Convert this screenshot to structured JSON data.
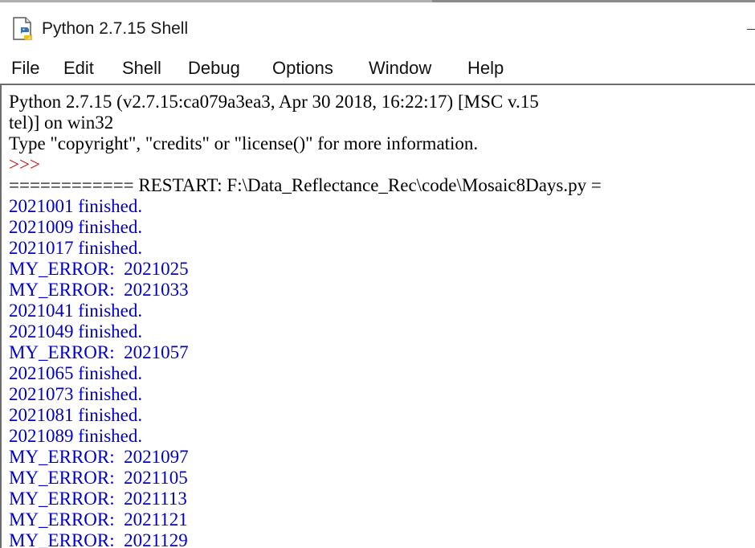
{
  "window": {
    "title": "Python 2.7.15 Shell"
  },
  "menu": [
    {
      "label": "File"
    },
    {
      "label": "Edit"
    },
    {
      "label": "Shell"
    },
    {
      "label": "Debug"
    },
    {
      "label": "Options"
    },
    {
      "label": "Window"
    },
    {
      "label": "Help"
    }
  ],
  "icons": {
    "app": "python-idle-icon",
    "minimize": "minimize-icon"
  },
  "colors": {
    "stdout": "#000000",
    "prompt": "#c00000",
    "output": "#0000c8"
  },
  "shell": {
    "lines": [
      {
        "text": "Python 2.7.15 (v2.7.15:ca079a3ea3, Apr 30 2018, 16:22:17) [MSC v.15",
        "style": "stdout"
      },
      {
        "text": "tel)] on win32",
        "style": "stdout"
      },
      {
        "text": "Type \"copyright\", \"credits\" or \"license()\" for more information.",
        "style": "stdout"
      },
      {
        "text": ">>>",
        "style": "prompt"
      },
      {
        "text": "============ RESTART: F:\\Data_Reflectance_Rec\\code\\Mosaic8Days.py =",
        "style": "stdout"
      },
      {
        "text": "2021001 finished.",
        "style": "output"
      },
      {
        "text": "2021009 finished.",
        "style": "output"
      },
      {
        "text": "2021017 finished.",
        "style": "output"
      },
      {
        "text": "MY_ERROR:  2021025",
        "style": "output"
      },
      {
        "text": "MY_ERROR:  2021033",
        "style": "output"
      },
      {
        "text": "2021041 finished.",
        "style": "output"
      },
      {
        "text": "2021049 finished.",
        "style": "output"
      },
      {
        "text": "MY_ERROR:  2021057",
        "style": "output"
      },
      {
        "text": "2021065 finished.",
        "style": "output"
      },
      {
        "text": "2021073 finished.",
        "style": "output"
      },
      {
        "text": "2021081 finished.",
        "style": "output"
      },
      {
        "text": "2021089 finished.",
        "style": "output"
      },
      {
        "text": "MY_ERROR:  2021097",
        "style": "output"
      },
      {
        "text": "MY_ERROR:  2021105",
        "style": "output"
      },
      {
        "text": "MY_ERROR:  2021113",
        "style": "output"
      },
      {
        "text": "MY_ERROR:  2021121",
        "style": "output"
      },
      {
        "text": "MY_ERROR:  2021129",
        "style": "output"
      }
    ]
  }
}
